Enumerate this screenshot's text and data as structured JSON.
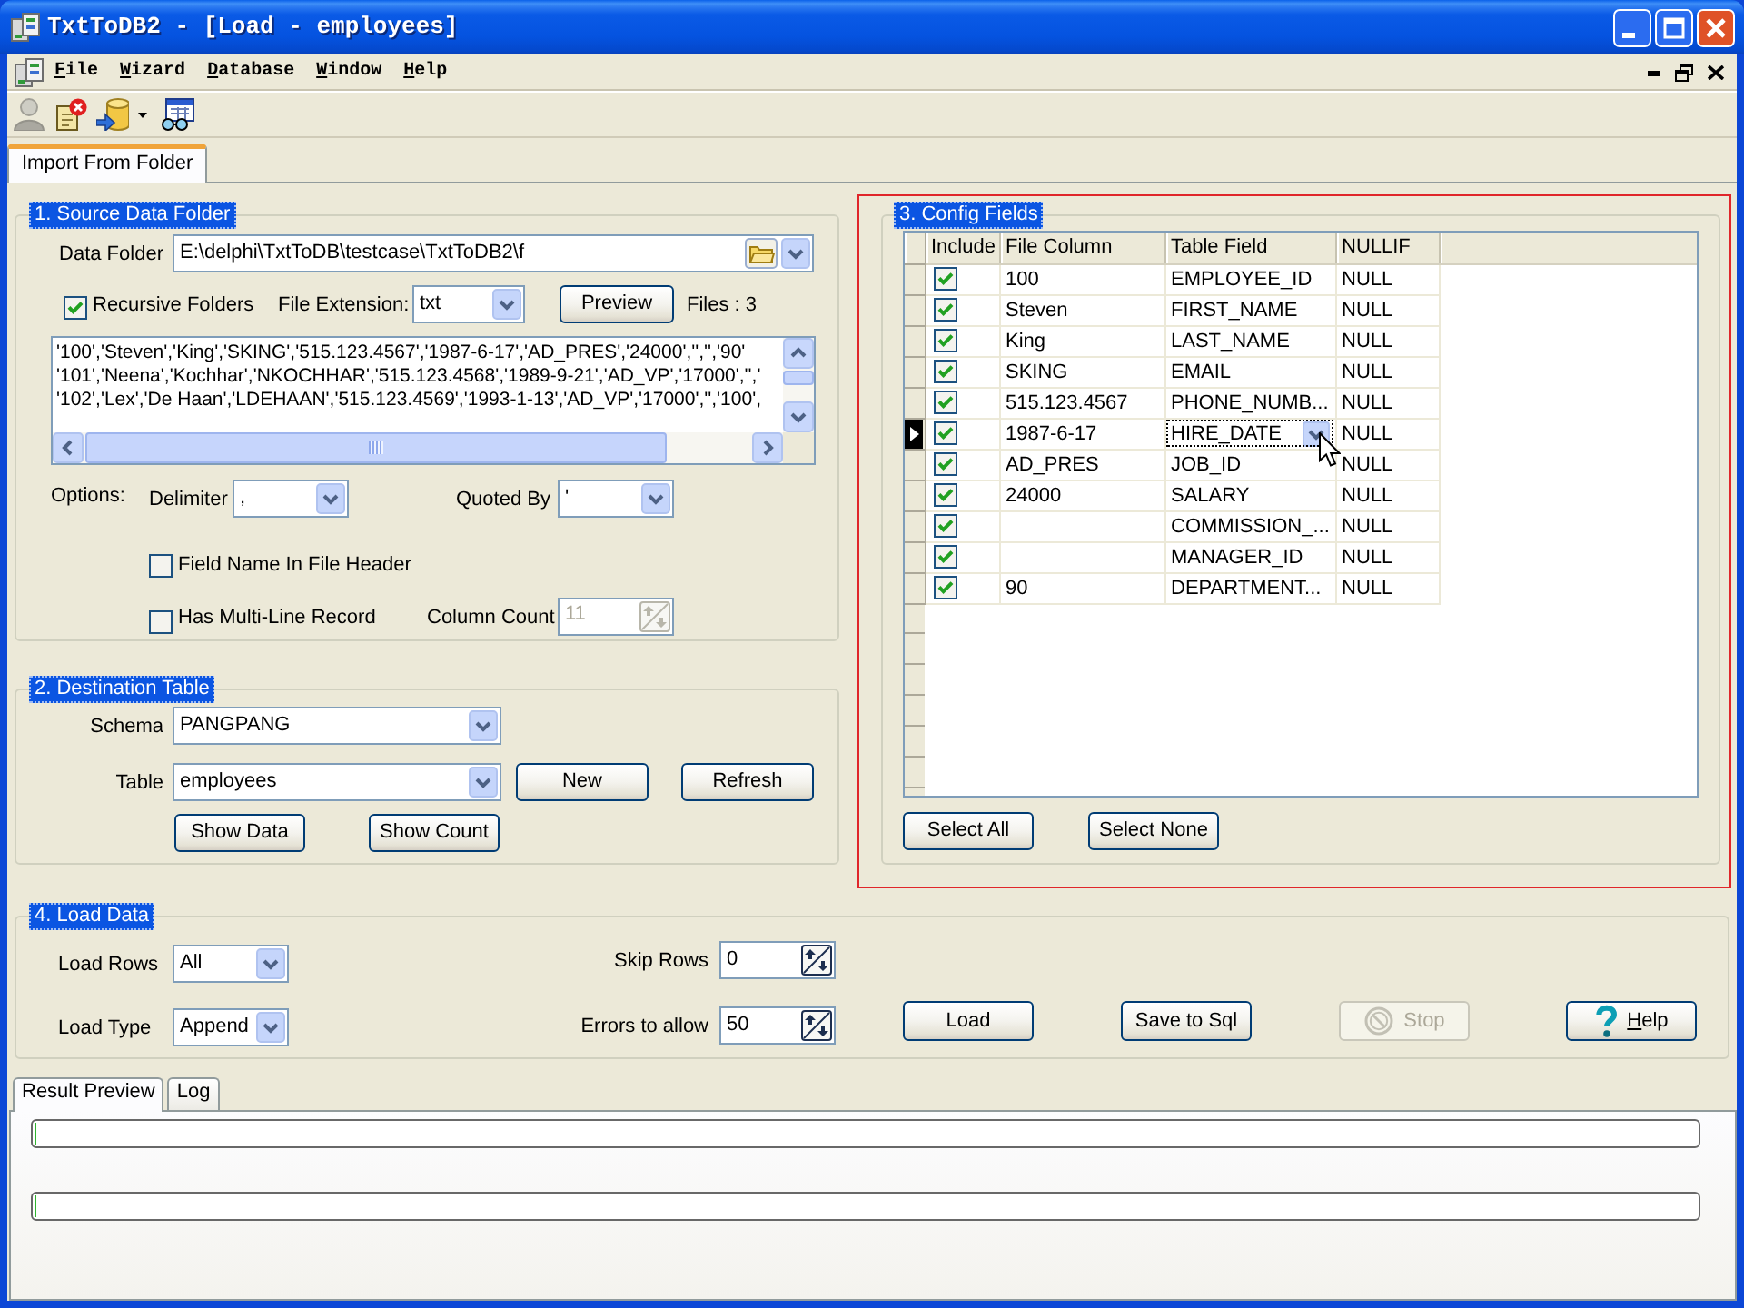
{
  "window": {
    "title": "TxtToDB2 - [Load - employees]"
  },
  "menu": [
    "File",
    "Wizard",
    "Database",
    "Window",
    "Help"
  ],
  "toolbar": [
    {
      "kind": "person",
      "disabled": true,
      "dropdown": false
    },
    {
      "kind": "disconnect",
      "disabled": false,
      "dropdown": false
    },
    {
      "kind": "import",
      "disabled": false,
      "dropdown": true
    },
    {
      "kind": "preview",
      "disabled": false,
      "dropdown": false
    }
  ],
  "tabs": [
    {
      "label": "Import From Folder",
      "selected": true
    }
  ],
  "source": {
    "title": "1. Source Data Folder",
    "data_folder": {
      "label": "Data Folder",
      "value": "E:\\delphi\\TxtToDB\\testcase\\TxtToDB2\\f"
    },
    "recursive_folders": {
      "label": "Recursive Folders",
      "checked": true
    },
    "file_extension": {
      "label": "File Extension:",
      "value": "txt"
    },
    "preview_button": "Preview",
    "files_count": "Files : 3",
    "preview_lines": [
      "'100','Steven','King','SKING','515.123.4567','1987-6-17','AD_PRES','24000','','','90'",
      "'101','Neena','Kochhar','NKOCHHAR','515.123.4568','1989-9-21','AD_VP','17000','','",
      "'102','Lex','De Haan','LDEHAAN','515.123.4569','1993-1-13','AD_VP','17000','','100',"
    ],
    "options_label": "Options:",
    "delimiter": {
      "label": "Delimiter",
      "value": ","
    },
    "quoted_by": {
      "label": "Quoted By",
      "value": "'"
    },
    "field_name_in_header": {
      "label": "Field Name In File Header",
      "checked": false
    },
    "multi_line_record": {
      "label": "Has Multi-Line Record",
      "checked": false
    },
    "column_count": {
      "label": "Column Count",
      "value": "11",
      "disabled": true
    }
  },
  "destination": {
    "title": "2. Destination Table",
    "schema": {
      "label": "Schema",
      "value": "PANGPANG"
    },
    "table": {
      "label": "Table",
      "value": "employees"
    },
    "new_button": "New",
    "refresh_button": "Refresh",
    "show_data_button": "Show Data",
    "show_count_button": "Show Count"
  },
  "config": {
    "title": "3. Config Fields",
    "columns": [
      "Include",
      "File Column",
      "Table Field",
      "NULLIF"
    ],
    "rows": [
      {
        "include": true,
        "file_column": "100",
        "table_field": "EMPLOYEE_ID",
        "nullif": "NULL",
        "selected": false
      },
      {
        "include": true,
        "file_column": "Steven",
        "table_field": "FIRST_NAME",
        "nullif": "NULL",
        "selected": false
      },
      {
        "include": true,
        "file_column": "King",
        "table_field": "LAST_NAME",
        "nullif": "NULL",
        "selected": false
      },
      {
        "include": true,
        "file_column": "SKING",
        "table_field": "EMAIL",
        "nullif": "NULL",
        "selected": false
      },
      {
        "include": true,
        "file_column": "515.123.4567",
        "table_field": "PHONE_NUMB...",
        "nullif": "NULL",
        "selected": false
      },
      {
        "include": true,
        "file_column": "1987-6-17",
        "table_field": "HIRE_DATE",
        "nullif": "NULL",
        "selected": true
      },
      {
        "include": true,
        "file_column": "AD_PRES",
        "table_field": "JOB_ID",
        "nullif": "NULL",
        "selected": false
      },
      {
        "include": true,
        "file_column": "24000",
        "table_field": "SALARY",
        "nullif": "NULL",
        "selected": false
      },
      {
        "include": true,
        "table_field": "COMMISSION_...",
        "nullif": "NULL",
        "selected": false
      },
      {
        "include": true,
        "table_field": "MANAGER_ID",
        "nullif": "NULL",
        "selected": false
      },
      {
        "include": true,
        "file_column": "90",
        "table_field": "DEPARTMENT...",
        "nullif": "NULL",
        "selected": false
      }
    ],
    "select_all_button": "Select All",
    "select_none_button": "Select None"
  },
  "load": {
    "title": "4. Load Data",
    "load_rows": {
      "label": "Load Rows",
      "value": "All"
    },
    "load_type": {
      "label": "Load Type",
      "value": "Append"
    },
    "skip_rows": {
      "label": "Skip Rows",
      "value": "0"
    },
    "errors_to_allow": {
      "label": "Errors to allow",
      "value": "50"
    },
    "buttons": [
      {
        "kind": "plain",
        "label": "Load",
        "disabled": false
      },
      {
        "kind": "plain",
        "label": "Save to Sql",
        "disabled": false
      },
      {
        "kind": "stop",
        "label": "Stop",
        "disabled": true
      },
      {
        "kind": "help",
        "label": "Help",
        "disabled": false
      }
    ]
  },
  "result_tabs": [
    {
      "label": "Result Preview",
      "selected": true
    },
    {
      "label": "Log",
      "selected": false
    }
  ],
  "progress_bars": [
    {
      "level": 0
    },
    {
      "level": 0
    }
  ]
}
